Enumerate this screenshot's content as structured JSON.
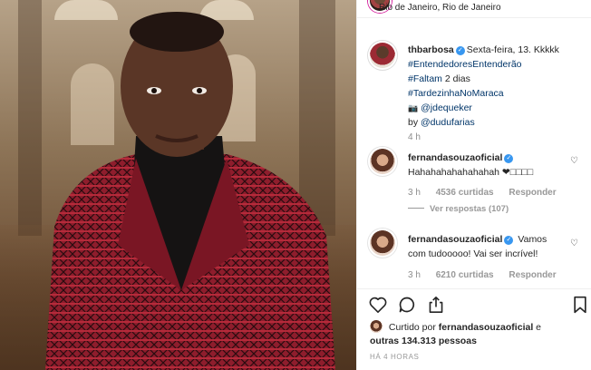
{
  "post": {
    "location": "Rio de Janeiro, Rio de Janeiro"
  },
  "caption": {
    "username": "thbarbosa",
    "text": "Sexta-feira, 13. Kkkkk",
    "hashtags": [
      "#EntendedoresEntenderão",
      "#Faltam",
      "#TardezinhaNoMaraca"
    ],
    "faltam_rest": "2 dias",
    "photo_credit": "@jdequeker",
    "by_prefix": "by",
    "by_handle": "@dudufarias",
    "time": "4 h"
  },
  "comments": [
    {
      "username": "fernandasouzaoficial",
      "text": "Hahahahahahahahah ❤□□□□",
      "time": "3 h",
      "likes": "4536 curtidas",
      "reply": "Responder"
    },
    {
      "username": "fernandasouzaoficial",
      "text": "Vamos com tudooooo! Vai ser incrível!",
      "time": "3 h",
      "likes": "6210 curtidas",
      "reply": "Responder"
    }
  ],
  "view_replies": "Ver respostas (107)",
  "likes": {
    "prefix": "Curtido por",
    "user": "fernandasouzaoficial",
    "suffix": "e",
    "others": "outras 134.313 pessoas"
  },
  "time_ago": "HÁ 4 HORAS",
  "icons": {
    "like": "heart-icon",
    "comment": "comment-icon",
    "share": "share-icon",
    "save": "bookmark-icon"
  }
}
